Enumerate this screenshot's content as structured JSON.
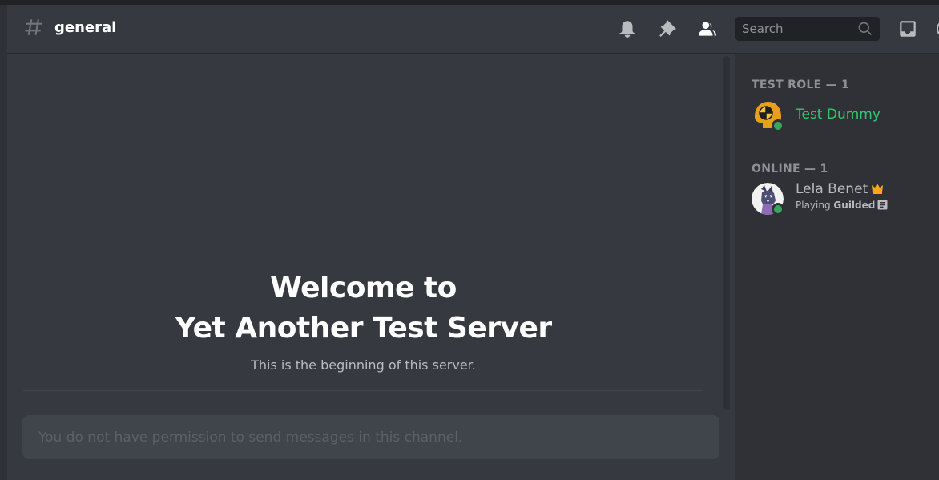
{
  "header": {
    "channel_name": "general",
    "search_placeholder": "Search"
  },
  "icons": {
    "channel": "hash-icon",
    "notifications": "bell-icon",
    "pins": "pin-icon",
    "members": "members-icon",
    "search": "search-icon",
    "inbox": "inbox-icon"
  },
  "welcome": {
    "title_line1": "Welcome to",
    "title_line2": "Yet Another Test Server",
    "subtitle": "This is the beginning of this server."
  },
  "composer": {
    "text": "You do not have permission to send messages in this channel."
  },
  "members": {
    "groups": [
      {
        "header": "TEST ROLE — 1",
        "members": [
          {
            "name": "Test Dummy",
            "name_color": "#2ecc71",
            "status": "online"
          }
        ]
      },
      {
        "header": "ONLINE — 1",
        "members": [
          {
            "name": "Lela Benet",
            "owner": true,
            "status": "online",
            "activity_prefix": "Playing",
            "activity_game": "Guilded"
          }
        ]
      }
    ]
  },
  "colors": {
    "background": "#36393f",
    "sidebar": "#2f3136",
    "online": "#3ba55c",
    "role": "#2ecc71",
    "crown": "#faa61a"
  }
}
